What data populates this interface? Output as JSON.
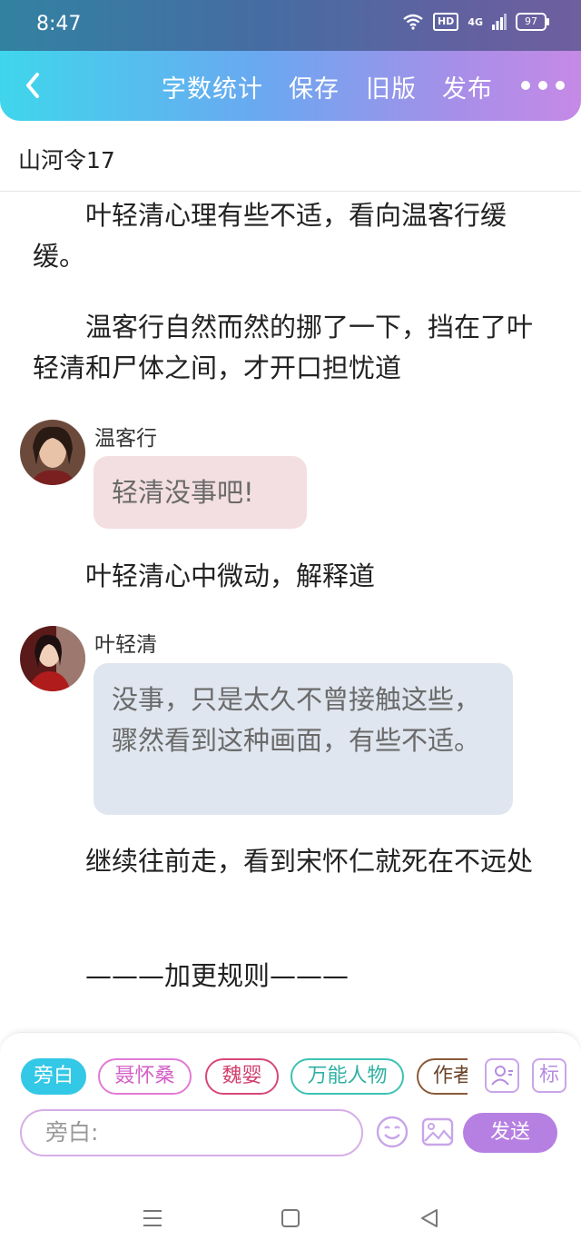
{
  "status": {
    "time": "8:47",
    "hd": "HD",
    "network": "4G",
    "battery": "97"
  },
  "header": {
    "buttons": [
      "字数统计",
      "保存",
      "旧版",
      "发布"
    ]
  },
  "doc_title": "山河令17",
  "content": {
    "p1": "叶轻清心理有些不适，看向温客行缓缓。",
    "p2": "温客行自然而然的挪了一下，挡在了叶轻清和尸体之间，才开口担忧道",
    "msg1": {
      "speaker": "温客行",
      "text": "轻清没事吧!"
    },
    "p3": "叶轻清心中微动，解释道",
    "msg2": {
      "speaker": "叶轻清",
      "text": "没事，只是太久不曾接触这些，骤然看到这种画面，有些不适。"
    },
    "p4": "继续往前走，看到宋怀仁就死在不远处",
    "p5": "———加更规则———"
  },
  "panel": {
    "chips": [
      "旁白",
      "聂怀桑",
      "魏婴",
      "万能人物",
      "作者"
    ],
    "tag_icon_label": "标",
    "input_placeholder": "旁白:",
    "send_label": "发送"
  },
  "colors": {
    "bubble_pink": "#f3dfe1",
    "bubble_blue": "#e0e6ef",
    "accent": "#b67fe2"
  }
}
